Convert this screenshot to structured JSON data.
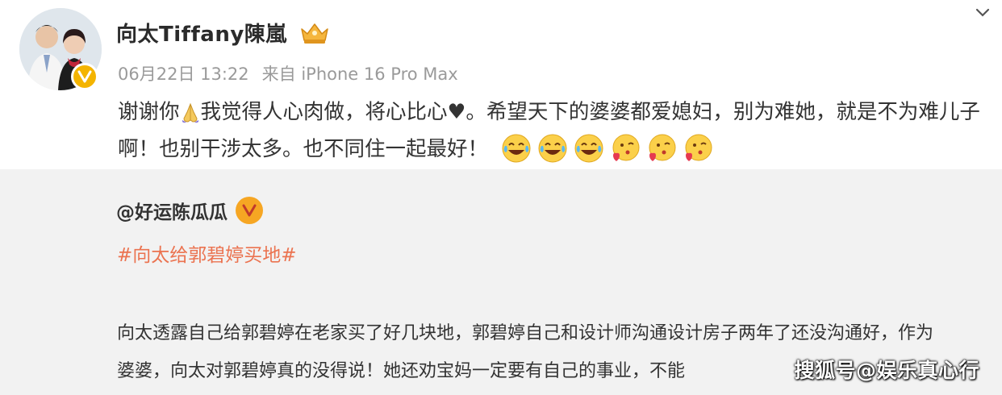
{
  "post": {
    "username": "向太Tiffany陳嵐",
    "date": "06月22日 13:22",
    "source": "来自 iPhone 16 Pro Max",
    "text_part1": "谢谢你",
    "text_part2": "我觉得人心肉做，将心比心♥。希望天下的婆婆都爱媳妇，别为难她，就是不为难儿子啊！也别干涉太多。也不同住一起最好！",
    "emojis": [
      "laugh-cry",
      "laugh-cry",
      "laugh-cry",
      "blow-kiss",
      "blow-kiss",
      "blow-kiss"
    ]
  },
  "repost": {
    "username": "@好运陈瓜瓜",
    "hashtag": "#向太给郭碧婷买地#",
    "body": "向太透露自己给郭碧婷在老家买了好几块地，郭碧婷自己和设计师沟通设计房子两年了还没沟通好，作为婆婆，向太对郭碧婷真的没得说！她还劝宝妈一定要有自己的事业，不能"
  },
  "watermark": "搜狐号@娱乐真心行",
  "colors": {
    "hashtag": "#eb7350",
    "meta": "#9a9a9a",
    "repost_bg": "#f2f2f2",
    "verified": "#f4b400"
  }
}
